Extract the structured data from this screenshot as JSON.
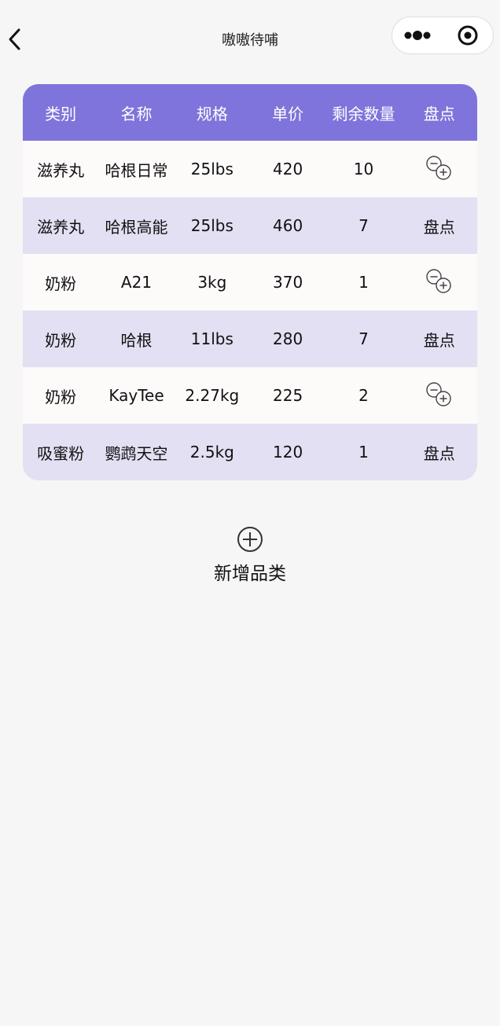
{
  "nav": {
    "title": "嗷嗷待哺",
    "back_icon": "chevron-left-icon",
    "more_icon": "more-dots-icon",
    "close_icon": "target-close-icon"
  },
  "colors": {
    "header_bg": "#7f74db",
    "row_light": "#fdfafa",
    "row_tint": "#e3e0f3",
    "page_bg": "#f6f6f6"
  },
  "table": {
    "headers": [
      "类别",
      "名称",
      "规格",
      "单价",
      "剩余数量",
      "盘点"
    ],
    "rows": [
      {
        "cat": "滋养丸",
        "name": "哈根日常",
        "spec": "25lbs",
        "price": "420",
        "qty": "10",
        "action": "",
        "action_icon": "minus-plus-adjust-icon"
      },
      {
        "cat": "滋养丸",
        "name": "哈根高能",
        "spec": "25lbs",
        "price": "460",
        "qty": "7",
        "action": "盘点"
      },
      {
        "cat": "奶粉",
        "name": "A21",
        "spec": "3kg",
        "price": "370",
        "qty": "1",
        "action": "",
        "action_icon": "minus-plus-adjust-icon"
      },
      {
        "cat": "奶粉",
        "name": "哈根",
        "spec": "11lbs",
        "price": "280",
        "qty": "7",
        "action": "盘点"
      },
      {
        "cat": "奶粉",
        "name": "KayTee",
        "spec": "2.27kg",
        "price": "225",
        "qty": "2",
        "action": "",
        "action_icon": "minus-plus-adjust-icon"
      },
      {
        "cat": "吸蜜粉",
        "name": "鹦鹉天空",
        "spec": "2.5kg",
        "price": "120",
        "qty": "1",
        "action": "盘点"
      }
    ]
  },
  "add_category": {
    "label": "新增品类",
    "icon": "plus-circle-icon"
  }
}
